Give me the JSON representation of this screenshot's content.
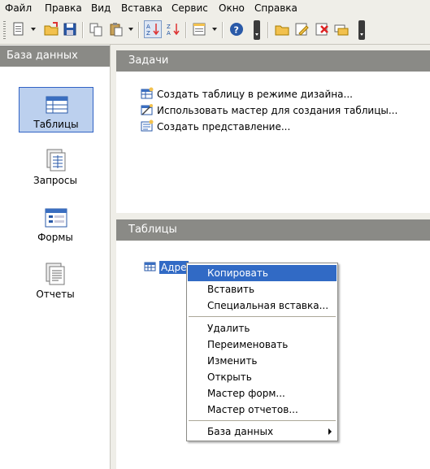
{
  "menubar": [
    "Файл",
    "Правка",
    "Вид",
    "Вставка",
    "Сервис",
    "Окно",
    "Справка"
  ],
  "left_panel": {
    "title": "База данных",
    "items": [
      {
        "label": "Таблицы",
        "icon": "table-icon",
        "selected": true
      },
      {
        "label": "Запросы",
        "icon": "query-icon",
        "selected": false
      },
      {
        "label": "Формы",
        "icon": "form-icon",
        "selected": false
      },
      {
        "label": "Отчеты",
        "icon": "report-icon",
        "selected": false
      }
    ]
  },
  "tasks": {
    "title": "Задачи",
    "items": [
      "Создать таблицу в режиме дизайна...",
      "Использовать мастер для создания таблицы...",
      "Создать представление..."
    ]
  },
  "tables": {
    "title": "Таблицы",
    "entry": "Адре"
  },
  "context_menu": {
    "group1": [
      "Копировать",
      "Вставить",
      "Специальная вставка..."
    ],
    "group2": [
      "Удалить",
      "Переименовать",
      "Изменить",
      "Открыть",
      "Мастер форм...",
      "Мастер отчетов..."
    ],
    "group3": [
      "База данных"
    ],
    "highlighted": "Копировать"
  },
  "colors": {
    "header_gray": "#8a8a86",
    "selection_blue": "#316ac5",
    "chrome": "#efeee8"
  }
}
